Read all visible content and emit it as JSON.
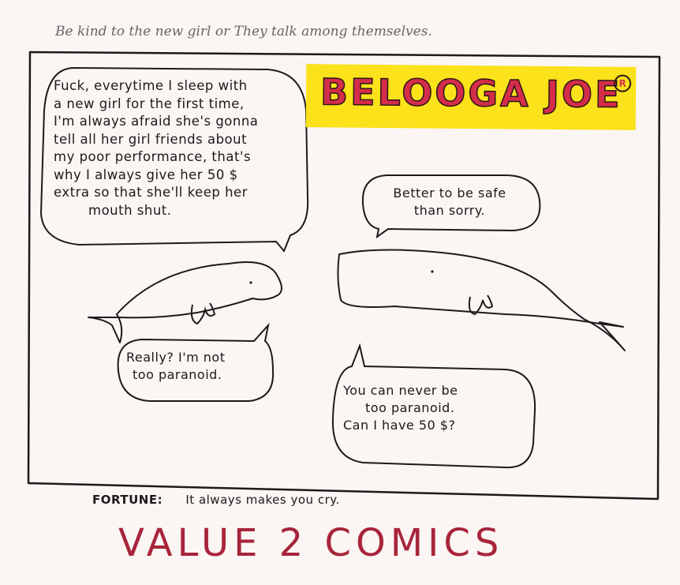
{
  "caption": "Be kind to the new girl or They talk among themselves.",
  "title": {
    "text": "BELOOGA JOE",
    "mark": "R"
  },
  "bubbles": [
    {
      "lines": [
        "Fuck, everytime I sleep with",
        "a new girl for the first time,",
        "I'm always afraid she's gonna",
        "tell all her girl friends about",
        "my poor performance, that's",
        "why I always give her 50 $",
        "extra so that she'll keep her",
        "mouth shut."
      ]
    },
    {
      "lines": [
        "Better to be safe",
        "than sorry."
      ]
    },
    {
      "lines": [
        "Really? I'm not",
        "too paranoid."
      ]
    },
    {
      "lines": [
        "You can never be",
        "too paranoid.",
        "Can I have 50 $?"
      ]
    }
  ],
  "fortune": {
    "label": "FORTUNE:",
    "text": "It always makes you cry."
  },
  "footer": "VALUE 2 COMICS",
  "colors": {
    "paper": "#fbf5f4",
    "banner": "#fbe21a",
    "title": "#d42d4a",
    "footer": "#a8243a",
    "ink": "#1c1a1a"
  }
}
